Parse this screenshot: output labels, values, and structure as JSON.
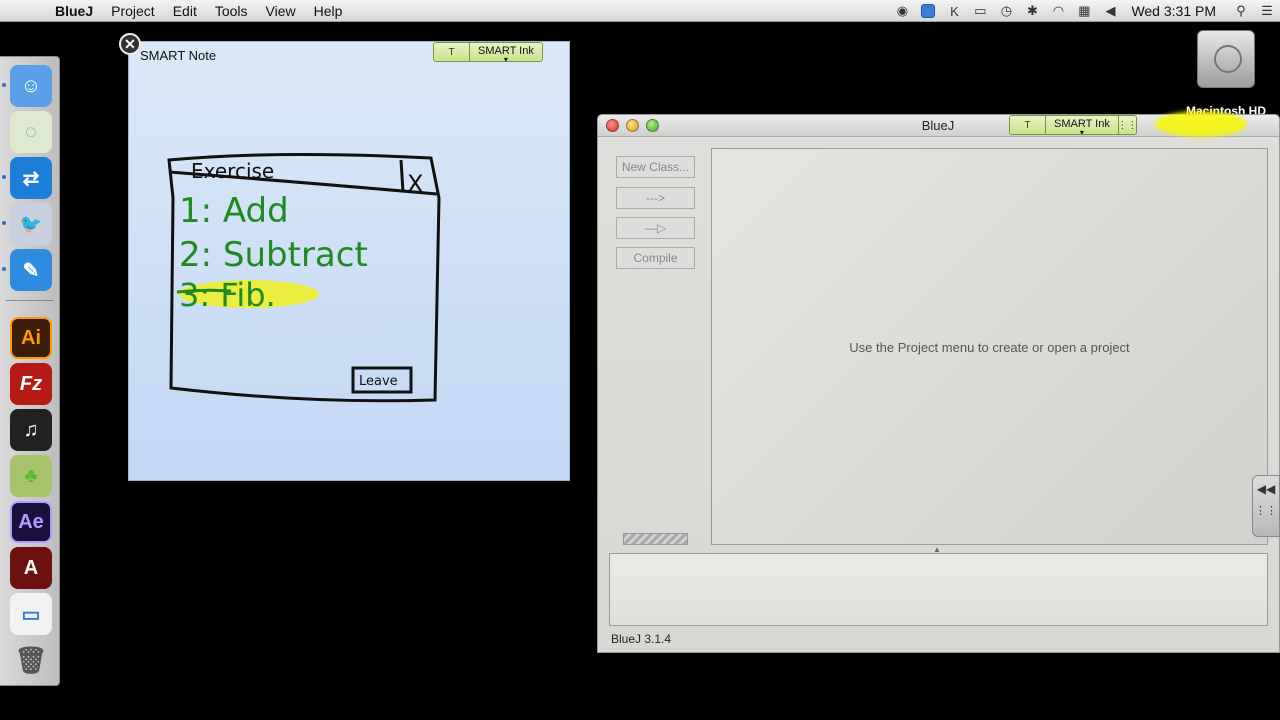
{
  "menubar": {
    "apple": "",
    "app_name": "BlueJ",
    "items": [
      "Project",
      "Edit",
      "Tools",
      "View",
      "Help"
    ],
    "clock": "Wed 3:31 PM"
  },
  "desktop": {
    "drive_label": "Macintosh HD"
  },
  "dock": {
    "items": [
      {
        "name": "finder",
        "label": "☺",
        "color": "#5aa0e8"
      },
      {
        "name": "loading",
        "label": "◌",
        "color": "#dfe9d0"
      },
      {
        "name": "teamviewer",
        "label": "⇄",
        "color": "#1d7ed8"
      },
      {
        "name": "bluej",
        "label": "🐦",
        "color": "#c8d0e0"
      },
      {
        "name": "notes",
        "label": "✎",
        "color": "#2e8be0"
      },
      {
        "name": "illustrator",
        "label": "Ai",
        "color": "#3b1d08"
      },
      {
        "name": "filezilla",
        "label": "Fz",
        "color": "#b61a14"
      },
      {
        "name": "piano",
        "label": "♫",
        "color": "#222222"
      },
      {
        "name": "character",
        "label": "♣",
        "color": "#a7c46d"
      },
      {
        "name": "after-effects",
        "label": "Ae",
        "color": "#1b0f3c"
      },
      {
        "name": "acrobat",
        "label": "A",
        "color": "#6e1111"
      },
      {
        "name": "document",
        "label": "▭",
        "color": "#f2f2f2"
      },
      {
        "name": "trash",
        "label": "🗑",
        "color": "#9a9a9a"
      }
    ]
  },
  "note": {
    "title": "SMART Note",
    "ink_label": "SMART Ink",
    "hand_label": "T",
    "sketch": {
      "header": "Exercise",
      "close": "X",
      "items": [
        "1: Add",
        "2: Subtract",
        "3: Fib."
      ],
      "button": "Leave"
    }
  },
  "bluej": {
    "title": "BlueJ",
    "ink_label": "SMART Ink",
    "hand_label": "T",
    "buttons": {
      "new_class": "New Class...",
      "dependency": "--->",
      "inheritance": "—▷",
      "compile": "Compile"
    },
    "canvas_message": "Use the Project menu to create or open a project",
    "version": "BlueJ 3.1.4"
  },
  "side_panel": {
    "icon": "◀◀"
  }
}
